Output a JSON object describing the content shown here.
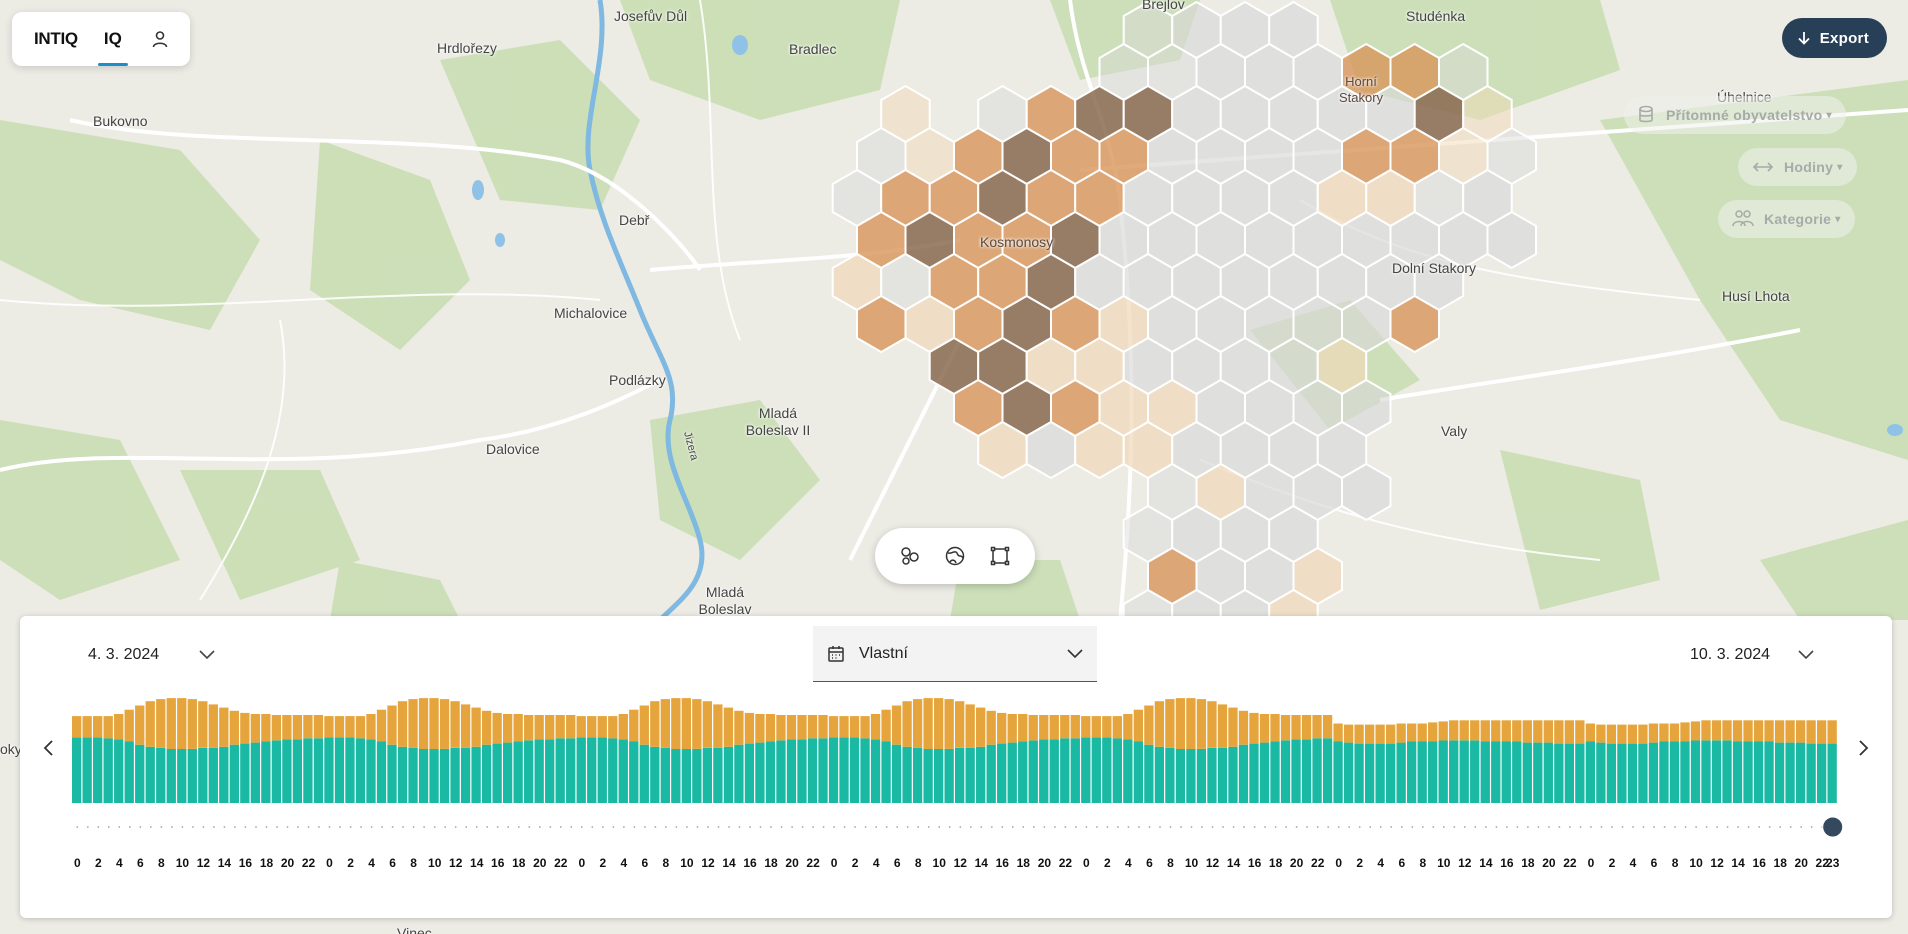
{
  "app": {
    "logo": "INTIQ",
    "tab": "IQ"
  },
  "header": {
    "export_label": "Export"
  },
  "filters": {
    "dataset": "Přítomné obyvatelstvo",
    "granularity": "Hodiny",
    "category": "Kategorie"
  },
  "map_labels": [
    "Josefův Důl",
    "Hrdlořezy",
    "Bradlec",
    "Brejlov",
    "Studénka",
    "Úhelnice",
    "Bukovno",
    "Debř",
    "Kosmonosy",
    "Dolní Stakory",
    "Husí Lhota",
    "Michalovice",
    "Podlázky",
    "Mladá Boleslav II",
    "Dalovice",
    "Valy",
    "Mladá Boleslav IV",
    "Horní Stakory",
    "Jizera",
    "Vinec",
    "oky"
  ],
  "timeline": {
    "start_date": "4. 3. 2024",
    "end_date": "10. 3. 2024",
    "range_mode": "Vlastní",
    "hour_labels": [
      "0",
      "2",
      "4",
      "6",
      "8",
      "10",
      "12",
      "14",
      "16",
      "18",
      "20",
      "22"
    ],
    "last_hour_label": "23",
    "days": 7
  },
  "chart_data": {
    "type": "bar",
    "stacked": true,
    "x_description": "hourly bins over 7 days",
    "series": [
      {
        "color": "#19b9a3"
      },
      {
        "color": "#e6a53c"
      }
    ],
    "day_profile_base": [
      0.62,
      0.62,
      0.62,
      0.61,
      0.6,
      0.58,
      0.55,
      0.53,
      0.52,
      0.51,
      0.51,
      0.51,
      0.52,
      0.52,
      0.53,
      0.55,
      0.56,
      0.57,
      0.58,
      0.59,
      0.6,
      0.6,
      0.61,
      0.61
    ],
    "day_profile_total": [
      0.82,
      0.82,
      0.82,
      0.82,
      0.84,
      0.88,
      0.92,
      0.96,
      0.98,
      0.99,
      0.99,
      0.98,
      0.96,
      0.93,
      0.9,
      0.87,
      0.85,
      0.84,
      0.84,
      0.83,
      0.83,
      0.83,
      0.83,
      0.83
    ],
    "weekend_profile_base": [
      0.58,
      0.57,
      0.56,
      0.56,
      0.56,
      0.56,
      0.57,
      0.58,
      0.58,
      0.58,
      0.59,
      0.59,
      0.59,
      0.59,
      0.58,
      0.58,
      0.58,
      0.58,
      0.57,
      0.57,
      0.57,
      0.56,
      0.56,
      0.56
    ],
    "weekend_profile_total": [
      0.75,
      0.74,
      0.74,
      0.74,
      0.74,
      0.74,
      0.75,
      0.75,
      0.75,
      0.76,
      0.77,
      0.78,
      0.78,
      0.78,
      0.78,
      0.78,
      0.78,
      0.78,
      0.78,
      0.78,
      0.78,
      0.78,
      0.78,
      0.78
    ],
    "selected_index": 167
  },
  "colors": {
    "accent": "#1a8ec8",
    "export_bg": "#284057",
    "hex_dark": "#8a6a50",
    "hex_mid": "#d8955a",
    "hex_light": "#f1d9b8",
    "hex_gray": "#d9d9d9"
  }
}
